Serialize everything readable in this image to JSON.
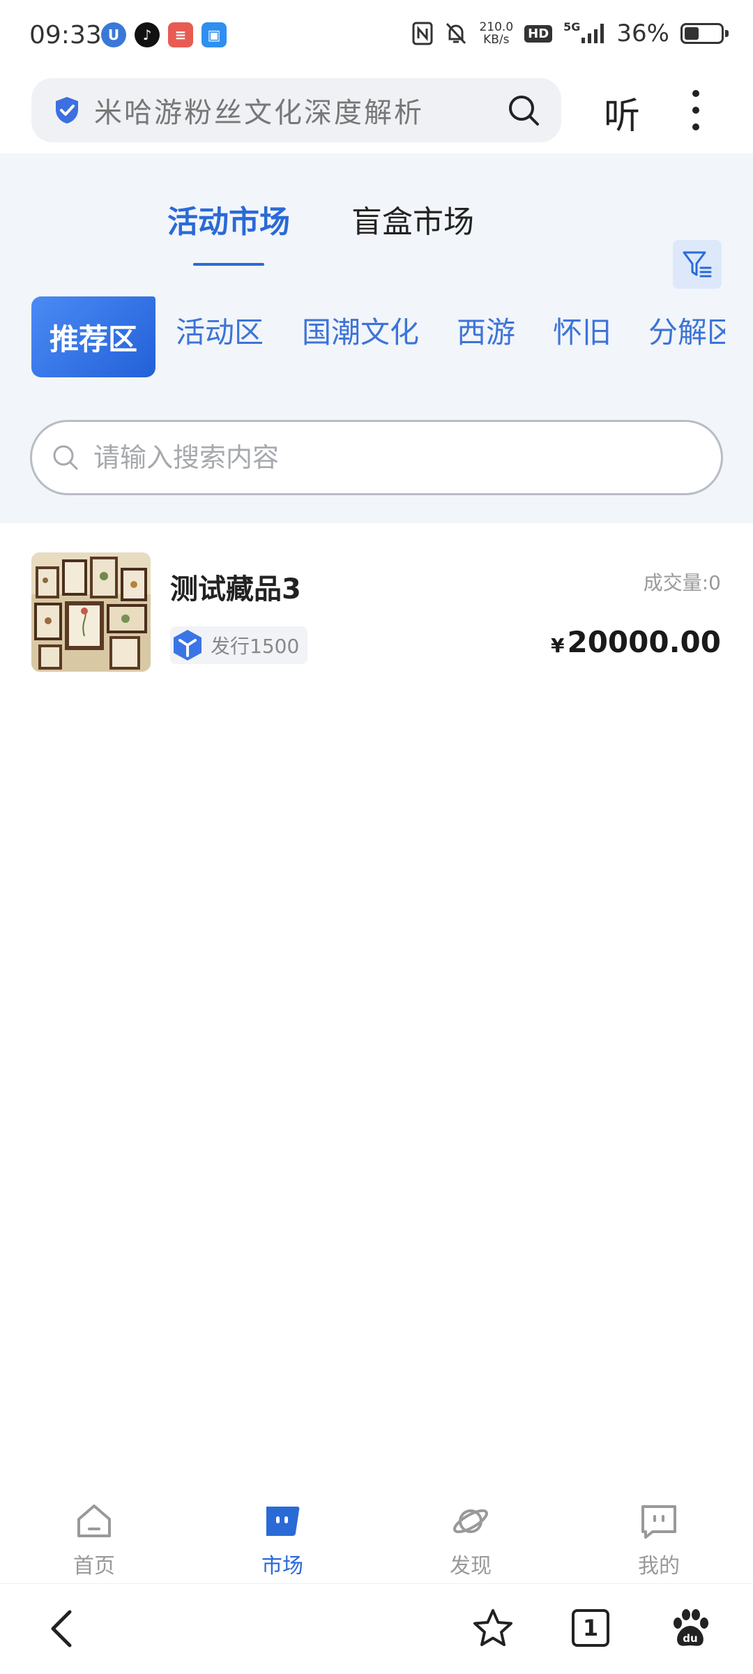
{
  "status_bar": {
    "time": "09:33",
    "net_speed_value": "210.0",
    "net_speed_unit": "KB/s",
    "hd": "HD",
    "signal": "5G",
    "battery": "36%",
    "battery_level": 0.36
  },
  "browser": {
    "url_text": "米哈游粉丝文化深度解析",
    "listen_label": "听"
  },
  "market": {
    "tabs": [
      {
        "label": "活动市场",
        "active": true
      },
      {
        "label": "盲盒市场",
        "active": false
      }
    ],
    "chips": [
      {
        "label": "推荐区",
        "active": true
      },
      {
        "label": "活动区"
      },
      {
        "label": "国潮文化"
      },
      {
        "label": "西游"
      },
      {
        "label": "怀旧"
      },
      {
        "label": "分解区"
      }
    ],
    "search_placeholder": "请输入搜索内容"
  },
  "items": [
    {
      "title": "测试藏品3",
      "issue": "发行1500",
      "volume": "成交量:0",
      "price_symbol": "¥",
      "price": "20000.00"
    }
  ],
  "tabbar": [
    {
      "label": "首页",
      "icon": "home-icon"
    },
    {
      "label": "市场",
      "icon": "market-icon",
      "active": true
    },
    {
      "label": "发现",
      "icon": "planet-icon"
    },
    {
      "label": "我的",
      "icon": "profile-icon"
    }
  ],
  "navbar": {
    "tab_count": "1"
  },
  "colors": {
    "accent": "#2a6ad6",
    "chip_text": "#3d74d8",
    "header_bg": "#f2f5f9"
  }
}
